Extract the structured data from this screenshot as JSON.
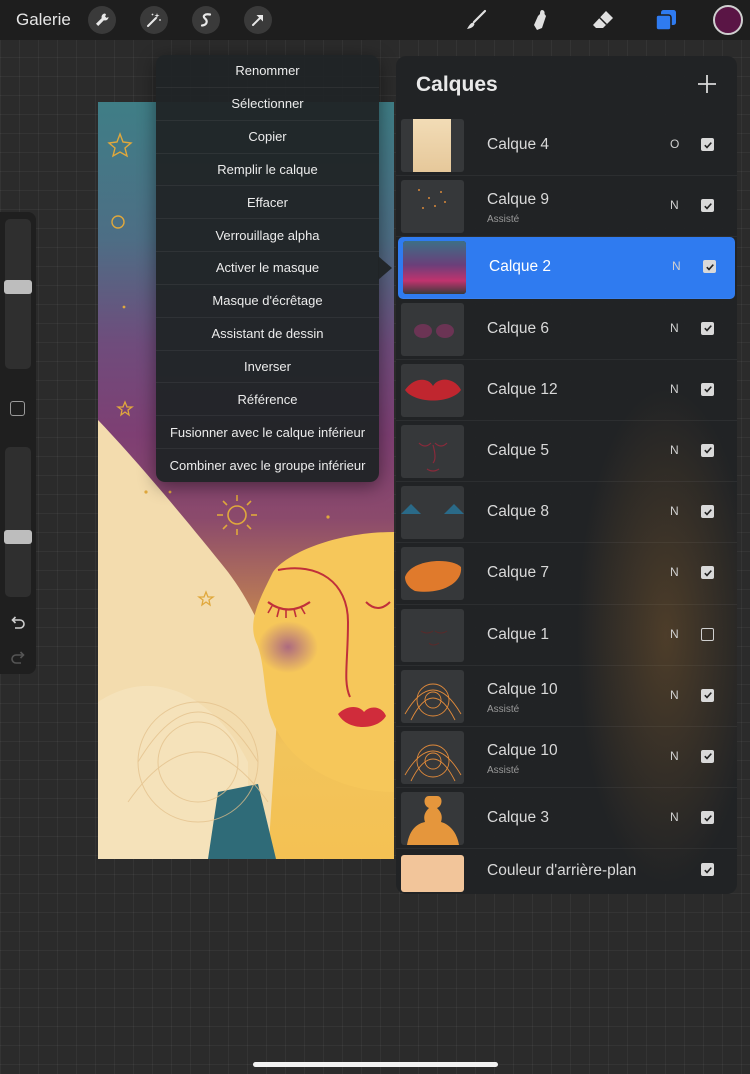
{
  "topbar": {
    "gallery_label": "Galerie",
    "left_tools": [
      "wrench-icon",
      "magic-wand-icon",
      "selection-icon",
      "transform-arrow-icon"
    ],
    "right_tools": [
      "brush-icon",
      "smudge-icon",
      "eraser-icon",
      "layers-icon"
    ],
    "current_color": "#5a1545",
    "active_tool_color": "#2f7bf0"
  },
  "context_menu": {
    "items": [
      "Renommer",
      "Sélectionner",
      "Copier",
      "Remplir le calque",
      "Effacer",
      "Verrouillage alpha",
      "Activer le masque",
      "Masque d'écrêtage",
      "Assistant de dessin",
      "Inverser",
      "Référence",
      "Fusionner avec le calque inférieur",
      "Combiner avec le groupe inférieur"
    ]
  },
  "layers_panel": {
    "title": "Calques",
    "add_icon": "plus-icon",
    "selected_index": 2,
    "layers": [
      {
        "name": "Calque 4",
        "sub": "",
        "blend": "O",
        "visible": true
      },
      {
        "name": "Calque 9",
        "sub": "Assisté",
        "blend": "N",
        "visible": true
      },
      {
        "name": "Calque 2",
        "sub": "",
        "blend": "N",
        "visible": true
      },
      {
        "name": "Calque 6",
        "sub": "",
        "blend": "N",
        "visible": true
      },
      {
        "name": "Calque 12",
        "sub": "",
        "blend": "N",
        "visible": true
      },
      {
        "name": "Calque 5",
        "sub": "",
        "blend": "N",
        "visible": true
      },
      {
        "name": "Calque 8",
        "sub": "",
        "blend": "N",
        "visible": true
      },
      {
        "name": "Calque 7",
        "sub": "",
        "blend": "N",
        "visible": true
      },
      {
        "name": "Calque 1",
        "sub": "",
        "blend": "N",
        "visible": false
      },
      {
        "name": "Calque 10",
        "sub": "Assisté",
        "blend": "N",
        "visible": true
      },
      {
        "name": "Calque 10",
        "sub": "Assisté",
        "blend": "N",
        "visible": true
      },
      {
        "name": "Calque 3",
        "sub": "",
        "blend": "N",
        "visible": true
      }
    ],
    "background": {
      "name": "Couleur d'arrière-plan",
      "color": "#f2c59a",
      "visible": true
    }
  },
  "sidebar": {
    "brush_size_level": 0.45,
    "opacity_level": 0.6,
    "icons": [
      "modifier-square-icon",
      "undo-icon",
      "redo-icon"
    ]
  }
}
